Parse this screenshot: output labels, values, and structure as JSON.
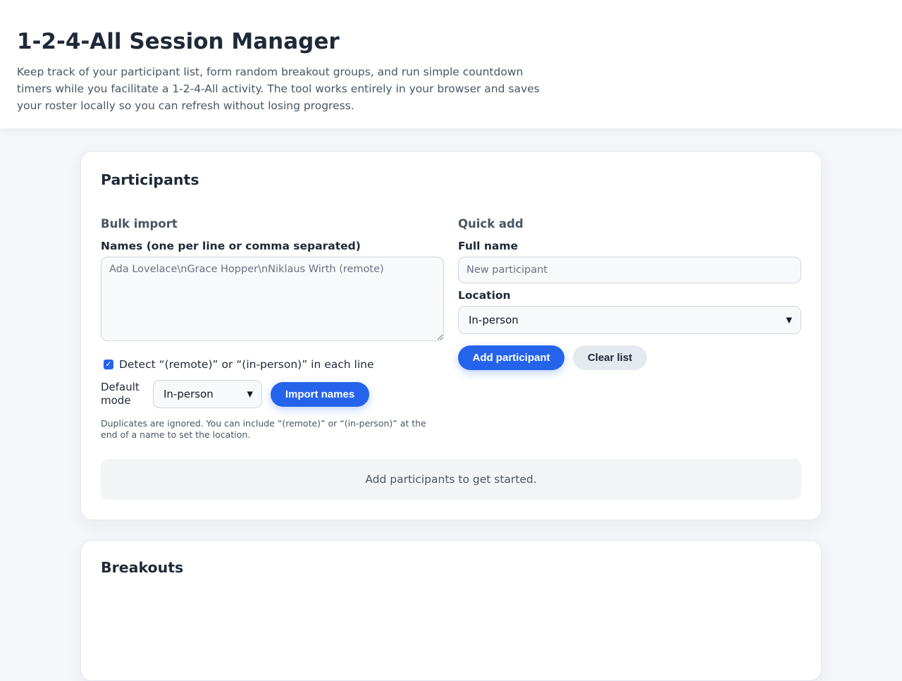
{
  "header": {
    "title": "1-2-4-All Session Manager",
    "description": "Keep track of your participant list, form random breakout groups, and run simple countdown timers while you facilitate a 1-2-4-All activity. The tool works entirely in your browser and saves your roster locally so you can refresh without losing progress."
  },
  "participants": {
    "title": "Participants",
    "bulk": {
      "heading": "Bulk import",
      "names_label": "Names (one per line or comma separated)",
      "names_placeholder": "Ada Lovelace\\nGrace Hopper\\nNiklaus Wirth (remote)",
      "detect_checked": true,
      "detect_label": "Detect “(remote)” or “(in-person)” in each line",
      "default_mode_label": "Default mode",
      "default_mode_value": "In-person",
      "import_button": "Import names",
      "hint": "Duplicates are ignored. You can include “(remote)” or “(in-person)” at the end of a name to set the location."
    },
    "quick": {
      "heading": "Quick add",
      "name_label": "Full name",
      "name_placeholder": "New participant",
      "location_label": "Location",
      "location_value": "In-person",
      "add_button": "Add participant",
      "clear_button": "Clear list"
    },
    "empty_message": "Add participants to get started."
  },
  "breakouts": {
    "title": "Breakouts"
  },
  "colors": {
    "accent": "#2563eb",
    "background": "#f5f6f9",
    "card": "#ffffff"
  }
}
